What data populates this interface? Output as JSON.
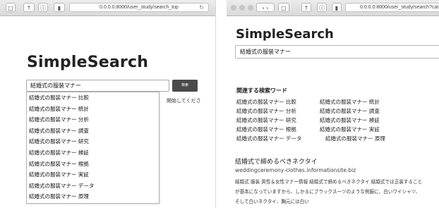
{
  "left": {
    "url": "0.0.0.0:8000/user_study/search_top",
    "logo": "SimpleSearch",
    "query": "結婚式の服装マナー",
    "search_button": "検索",
    "behind_text": "開始してくださ",
    "suggestions": [
      "結婚式の服装マナー 比較",
      "結婚式の服装マナー 統計",
      "結婚式の服装マナー 分析",
      "結婚式の服装マナー 調査",
      "結婚式の服装マナー 研究",
      "結婚式の服装マナー 検証",
      "結婚式の服装マナー 根拠",
      "結婚式の服装マナー 実証",
      "結婚式の服装マナー データ",
      "結婚式の服装マナー 原理"
    ]
  },
  "right": {
    "url": "0.0.0.0:8000/user_study/search?cat",
    "logo": "SimpleSearch",
    "query": "結婚式の服装マナー",
    "related_title": "関連する検索ワード",
    "related": [
      "結婚式の服装マナー 比較",
      "結婚式の服装マナー 統計",
      "結婚式の服装マナー 分析",
      "結婚式の服装マナー 調査",
      "結婚式の服装マナー 研究",
      "結婚式の服装マナー 検証",
      "結婚式の服装マナー 根拠",
      "結婚式の服装マナー 実証",
      "結婚式の服装マナー データ",
      "結婚式の服装マナー 原理"
    ],
    "result": {
      "title": "結婚式で締めるべきネクタイ",
      "url": "weddingceremony-clothes.informationsite.biz",
      "snippet": [
        "結婚式 服装 男性＆女性マナー情報 結婚式で締めるべきネクタイ 結婚式では正装すること",
        "が基本になっていますから、しかるにブラックスーツのような例服に、白いワイシャツ、",
        "そして白いネクタイ、胸元には白い"
      ]
    }
  }
}
